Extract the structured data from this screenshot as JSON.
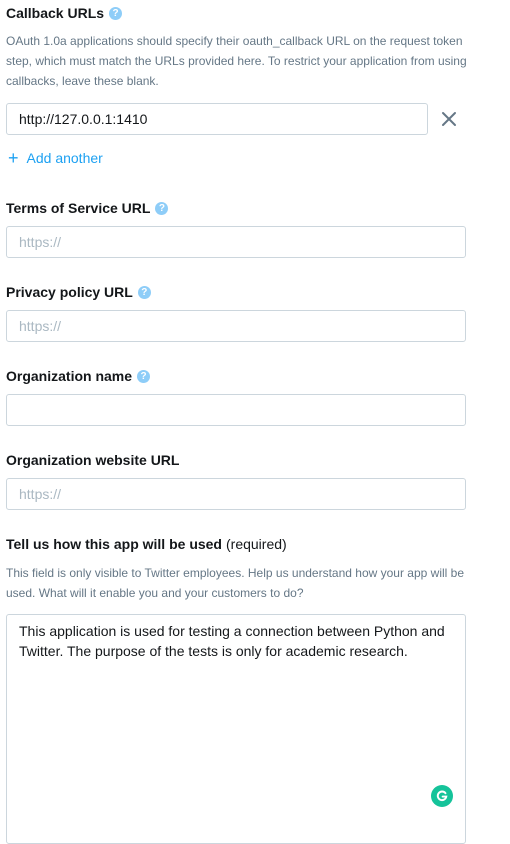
{
  "callback": {
    "label": "Callback URLs",
    "help_icon": "?",
    "description": "OAuth 1.0a applications should specify their oauth_callback URL on the request token step, which must match the URLs provided here. To restrict your application from using callbacks, leave these blank.",
    "url_value": "http://127.0.0.1:1410",
    "add_label": "Add another"
  },
  "tos": {
    "label": "Terms of Service URL",
    "help_icon": "?",
    "placeholder": "https://"
  },
  "privacy": {
    "label": "Privacy policy URL",
    "help_icon": "?",
    "placeholder": "https://"
  },
  "org_name": {
    "label": "Organization name",
    "help_icon": "?",
    "value": ""
  },
  "org_website": {
    "label": "Organization website URL",
    "placeholder": "https://"
  },
  "usage": {
    "label": "Tell us how this app will be used",
    "required": "(required)",
    "description": "This field is only visible to Twitter employees. Help us understand how your app will be used. What will it enable you and your customers to do?",
    "value": "This application is used for testing a connection between Python and Twitter. The purpose of the tests is only for academic research."
  },
  "icons": {
    "help": "question-mark-icon",
    "clear": "close-icon",
    "add": "plus-icon",
    "grammarly": "grammarly-icon"
  },
  "colors": {
    "accent": "#1da1f2",
    "help": "#8ecdf8",
    "border": "#ccd6dd",
    "muted": "#657786",
    "grammarly": "#15c39a"
  }
}
